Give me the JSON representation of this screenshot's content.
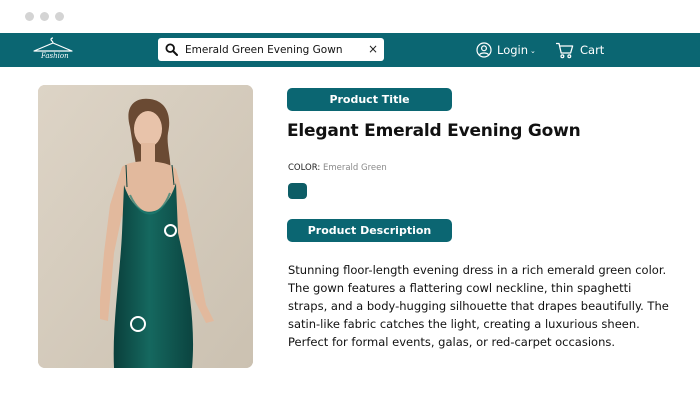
{
  "navbar": {
    "logo_text": "Fashion",
    "search": {
      "value": "Emerald Green Evening Gown",
      "clear_label": "×"
    },
    "login_label": "Login",
    "login_caret": "⌄",
    "cart_label": "Cart"
  },
  "product": {
    "title_pill": "Product Title",
    "title": "Elegant Emerald Evening Gown",
    "color_label": "COLOR:",
    "color_value": "Emerald Green",
    "swatch_color": "#0d5d66",
    "description_pill": "Product Description",
    "description": "Stunning floor-length evening dress in a rich emerald green color. The gown features a flattering cowl neckline, thin spaghetti straps, and a body-hugging silhouette that drapes beautifully. The satin-like fabric catches the light, creating a luxurious sheen. Perfect for formal events, galas, or red-carpet occasions."
  },
  "theme": {
    "accent": "#0b6672",
    "chrome_dot": "#d4d4d4"
  }
}
